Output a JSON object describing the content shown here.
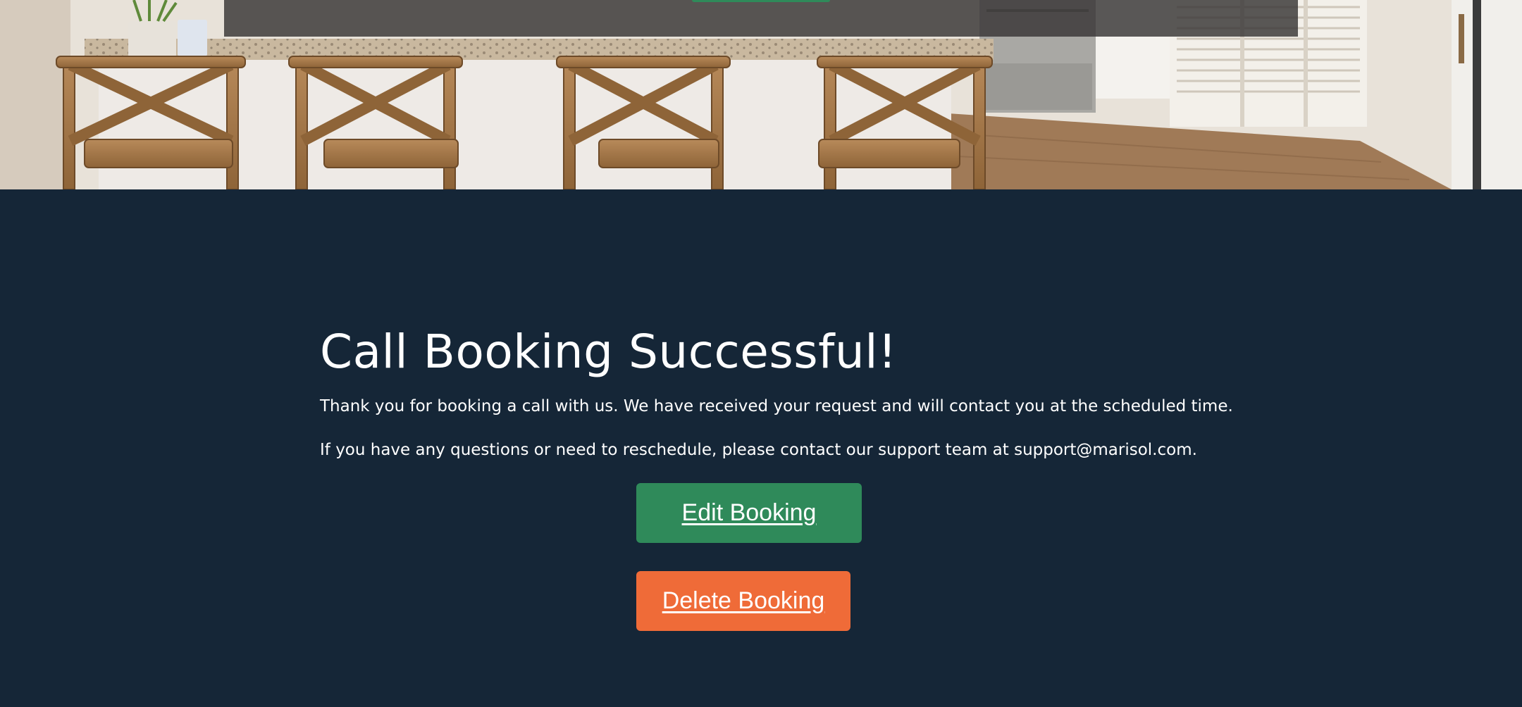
{
  "hero": {
    "image": "kitchen-bar-stools-photo"
  },
  "colors": {
    "background": "#152637",
    "edit_button": "#2f8a5a",
    "delete_button": "#ef6b38",
    "text": "#ffffff"
  },
  "confirmation": {
    "title": "Call Booking Successful!",
    "message": "Thank you for booking a call with us. We have received your request and will contact you at the scheduled time.",
    "support_note": "If you have any questions or need to reschedule, please contact our support team at support@marisol.com."
  },
  "actions": {
    "edit_label": "Edit Booking",
    "delete_label": "Delete Booking"
  }
}
